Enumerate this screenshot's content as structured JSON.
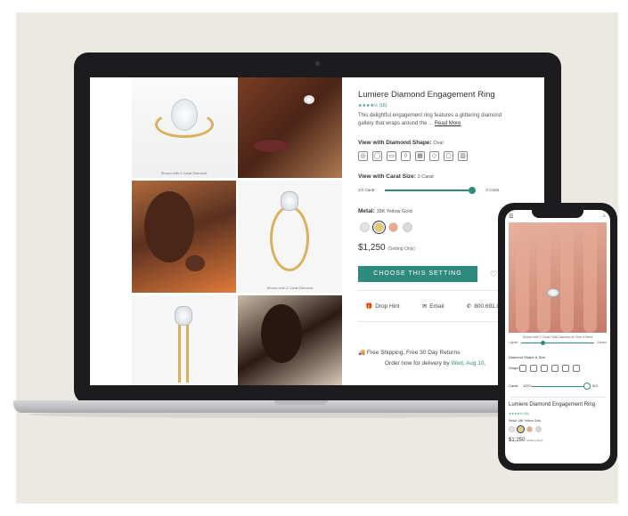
{
  "laptop": {
    "grid": {
      "tile1_caption": "Shown with 2 Carat Diamond",
      "tile4_caption": "Shown with 2 Carat Diamond"
    },
    "product": {
      "title": "Lumiere Diamond Engagement Ring",
      "rating": "★★★★½ (16)",
      "description": "This delightful engagement ring features a glittering diamond gallery that wraps around the ...",
      "read_more": "Read More",
      "shape_label": "View with Diamond Shape:",
      "shape_value": "Oval",
      "shapes": [
        "round-icon",
        "oval-icon",
        "emerald-icon",
        "pear-icon",
        "princess-icon",
        "marquise-icon",
        "cushion-icon",
        "radiant-icon"
      ],
      "carat_label": "View with Carat Size:",
      "carat_value": "2 Carat",
      "carat_min": "1/2 Carat",
      "carat_max": "3 Carat",
      "carat_level": 0.98,
      "metal_label": "Metal:",
      "metal_value": "18K Yellow Gold",
      "metals": [
        {
          "name": "white-gold",
          "color": "#e4e4e4"
        },
        {
          "name": "yellow-gold",
          "color": "#e8c96a"
        },
        {
          "name": "rose-gold",
          "color": "#e9a88c"
        },
        {
          "name": "platinum",
          "color": "#d9d9d9"
        }
      ],
      "price": "$1,250",
      "price_note": "(Setting Only)",
      "cta": "CHOOSE THIS SETTING",
      "drop_hint": "Drop Hint",
      "email": "Email",
      "phone": "800.691.0952",
      "shipping": "Free Shipping, Free 30 Day Returns",
      "order_prefix": "Order now for delivery by",
      "order_date": "Wed, Aug 10,"
    }
  },
  "phone": {
    "photo_caption": "Shown with 2 Carat Oval Diamond on Size 4 Hand",
    "slider_left": "Lighter",
    "slider_right": "Darker",
    "section_label": "Diamond Shape & Size",
    "shape_label": "Shape:",
    "carat_label": "Carat:",
    "carat_min": "1/2Ct",
    "carat_max": "3Ct",
    "title": "Lumiere Diamond Engagement Ring",
    "rating": "★★★★½ (16)",
    "metal_label": "Metal: 18K Yellow Gold",
    "price": "$1,250",
    "price_note": "(Setting Only)",
    "colors": {
      "accent": "#2f8a7e"
    }
  }
}
